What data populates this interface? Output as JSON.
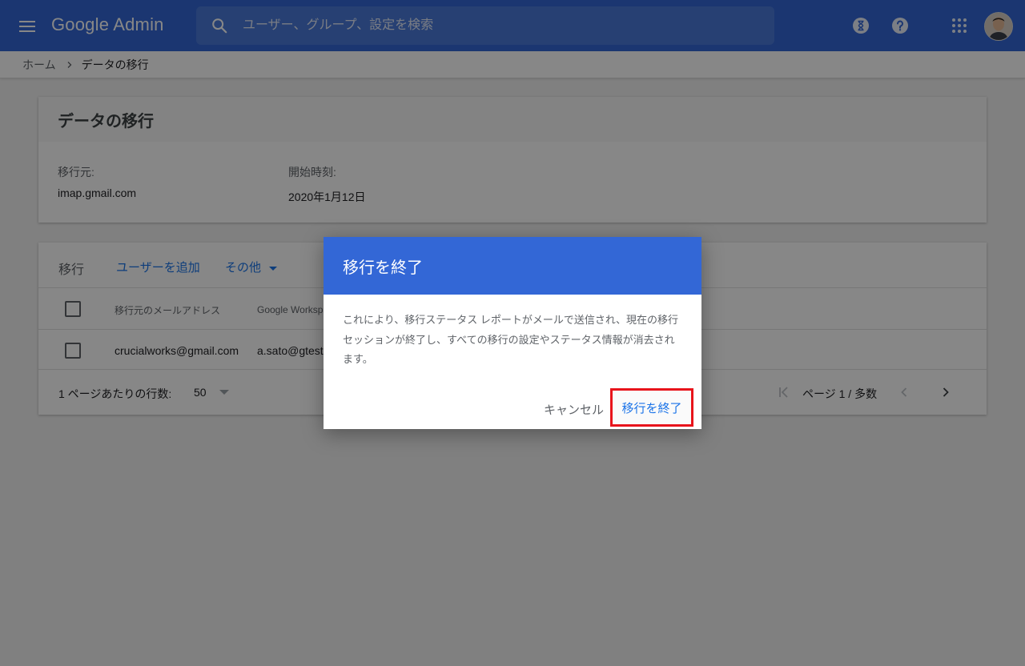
{
  "app": {
    "title": "Google Admin"
  },
  "search": {
    "placeholder": "ユーザー、グループ、設定を検索"
  },
  "header_icons": [
    "hourglass-icon",
    "help-icon",
    "apps-grid-icon",
    "user-avatar"
  ],
  "breadcrumb": {
    "home": "ホーム",
    "current": "データの移行"
  },
  "summary": {
    "title": "データの移行",
    "source_label": "移行元:",
    "source_value": "imap.gmail.com",
    "start_label": "開始時刻:",
    "start_value": "2020年1月12日"
  },
  "migrations": {
    "title": "移行",
    "add_user": "ユーザーを追加",
    "more": "その他",
    "columns": [
      "移行元のメールアドレス",
      "Google Worksp"
    ],
    "rows": [
      {
        "source_email": "crucialworks@gmail.com",
        "target_email": "a.sato@gtest"
      }
    ],
    "rows_per_page_label": "1 ページあたりの行数:",
    "rows_per_page": "50",
    "pagination": "ページ 1 / 多数"
  },
  "dialog": {
    "title": "移行を終了",
    "body": "これにより、移行ステータス レポートがメールで送信され、現在の移行セッションが終了し、すべての移行の設定やステータス情報が消去されます。",
    "cancel": "キャンセル",
    "confirm": "移行を終了"
  },
  "colors": {
    "brand_blue": "#3367d6",
    "link_blue": "#1a73e8",
    "highlight_red": "#e8141b"
  }
}
